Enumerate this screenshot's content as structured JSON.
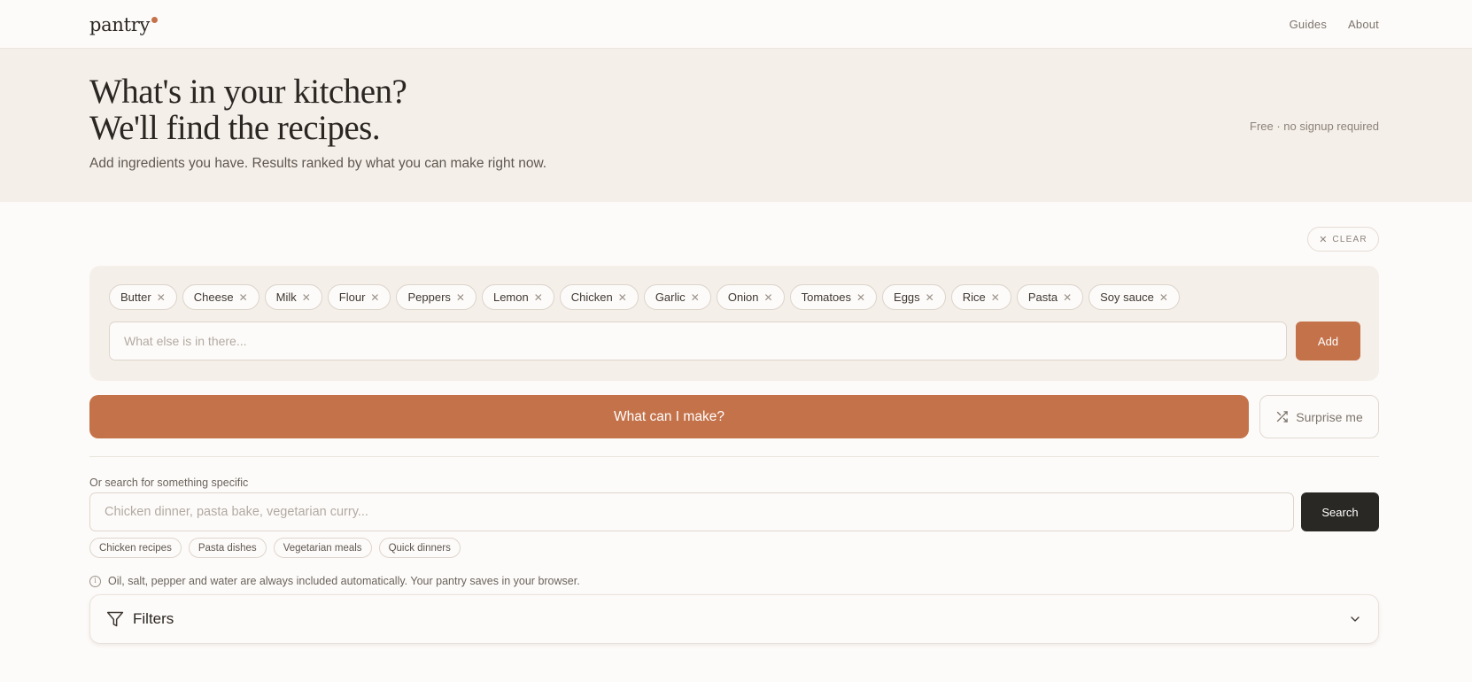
{
  "nav": {
    "logo": "pantry",
    "links": [
      "Guides",
      "About"
    ]
  },
  "hero": {
    "title_line1": "What's in your kitchen?",
    "title_line2": "We'll find the recipes.",
    "subtitle": "Add ingredients you have. Results ranked by what you can make right now.",
    "side_note": "Free · no signup required"
  },
  "clear": {
    "label": "CLEAR"
  },
  "ingredients": {
    "chips": [
      "Butter",
      "Cheese",
      "Milk",
      "Flour",
      "Peppers",
      "Lemon",
      "Chicken",
      "Garlic",
      "Onion",
      "Tomatoes",
      "Eggs",
      "Rice",
      "Pasta",
      "Soy sauce"
    ],
    "input_placeholder": "What else is in there...",
    "add_label": "Add"
  },
  "actions": {
    "make_label": "What can I make?",
    "surprise_label": "Surprise me"
  },
  "search": {
    "label": "Or search for something specific",
    "placeholder": "Chicken dinner, pasta bake, vegetarian curry...",
    "button_label": "Search",
    "suggestions": [
      "Chicken recipes",
      "Pasta dishes",
      "Vegetarian meals",
      "Quick dinners"
    ]
  },
  "note": "Oil, salt, pepper and water are always included automatically. Your pantry saves in your browser.",
  "filters": {
    "label": "Filters"
  },
  "colors": {
    "accent": "#c4724a",
    "dark": "#2a2824",
    "hero_bg": "#f5efe9",
    "page_bg": "#fdfbf9"
  }
}
